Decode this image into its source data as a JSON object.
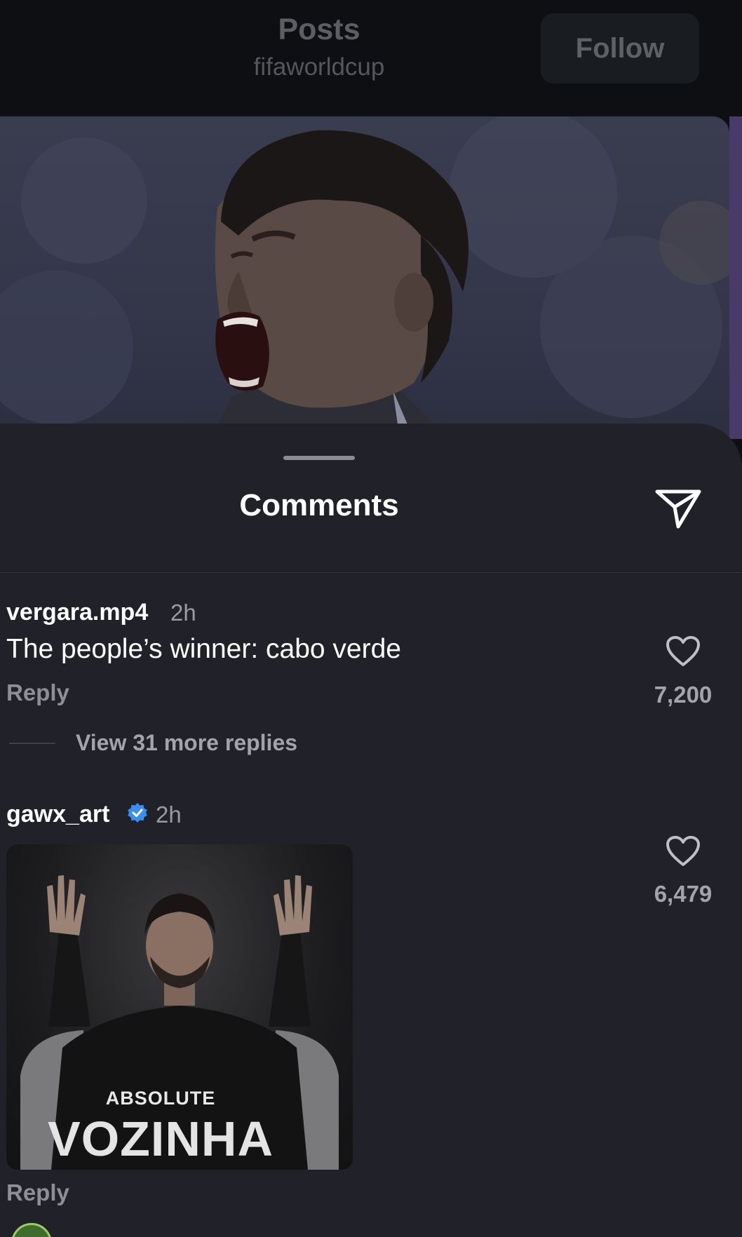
{
  "header": {
    "title": "Posts",
    "subtitle": "fifaworldcup",
    "follow_label": "Follow"
  },
  "sheet": {
    "title": "Comments"
  },
  "comments": [
    {
      "username": "vergara.mp4",
      "time": "2h",
      "text": "The people’s winner: cabo verde",
      "reply_label": "Reply",
      "likes": "7,200",
      "view_replies_label": "View 31 more replies"
    },
    {
      "username": "gawx_art",
      "verified": true,
      "time": "2h",
      "gif_caption_small": "ABSOLUTE",
      "gif_caption_big": "VOZINHA",
      "reply_label": "Reply",
      "likes": "6,479"
    }
  ],
  "icons": {
    "share": "paper-plane-icon",
    "like": "heart-icon",
    "verified": "verified-badge-icon"
  },
  "colors": {
    "sheet_background": "#212229",
    "verified_blue": "#3b8df2"
  }
}
